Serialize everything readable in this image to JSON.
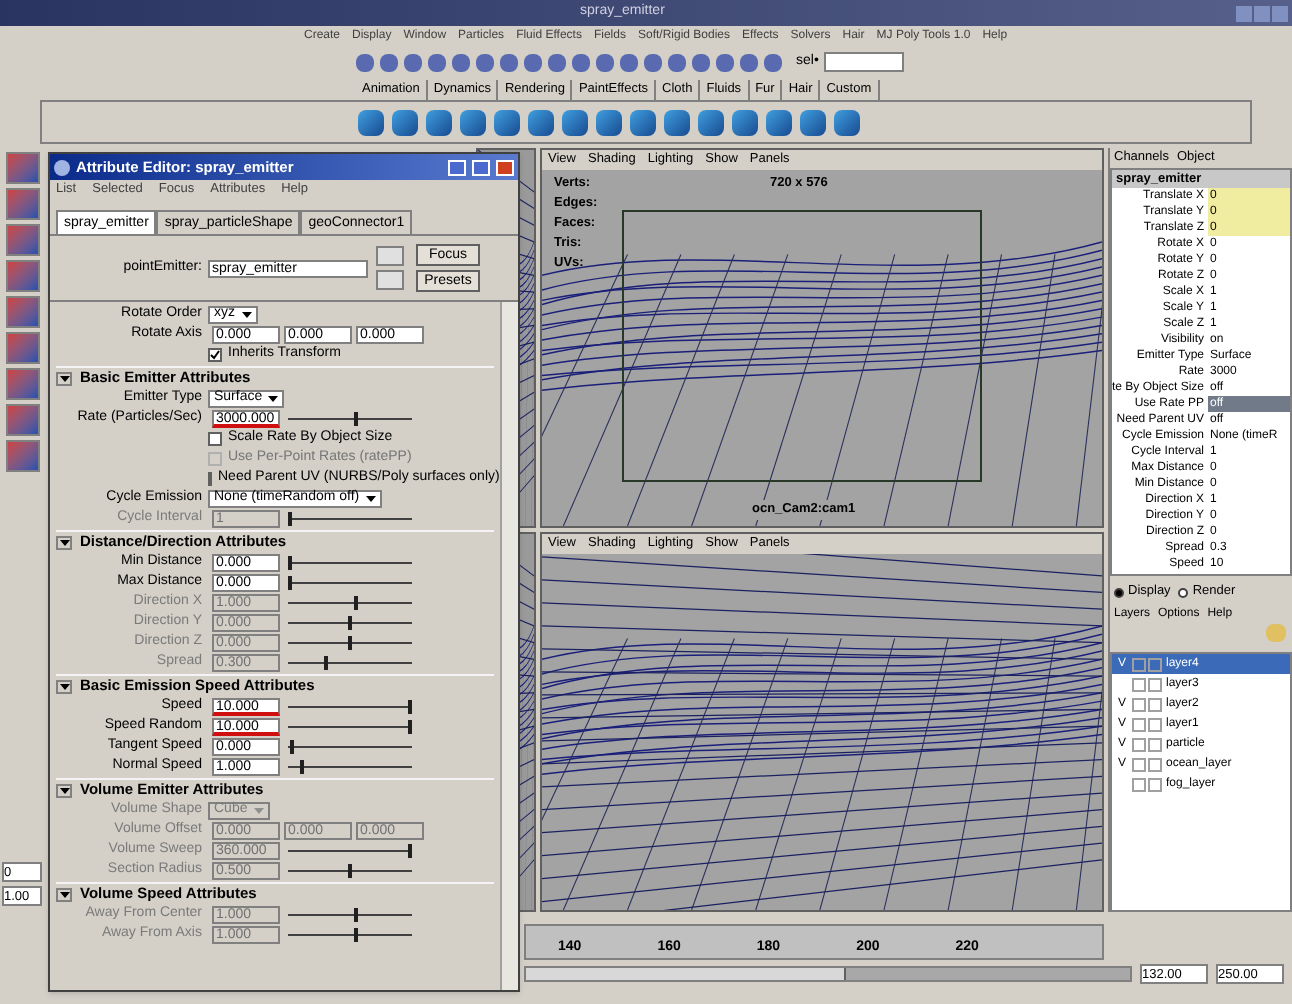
{
  "main_window": {
    "title": "spray_emitter"
  },
  "menu": [
    "Create",
    "Display",
    "Window",
    "Particles",
    "Fluid Effects",
    "Fields",
    "Soft/Rigid Bodies",
    "Effects",
    "Solvers",
    "Hair",
    "MJ Poly Tools 1.0",
    "Help"
  ],
  "toolbar": {
    "selection_label": "sel•"
  },
  "shelf_tabs": [
    {
      "label": "Animation",
      "selected": false
    },
    {
      "label": "Dynamics",
      "selected": false
    },
    {
      "label": "Rendering",
      "selected": false
    },
    {
      "label": "PaintEffects",
      "selected": false
    },
    {
      "label": "Cloth",
      "selected": false
    },
    {
      "label": "Fluids",
      "selected": false
    },
    {
      "label": "Fur",
      "selected": false
    },
    {
      "label": "Hair",
      "selected": false
    },
    {
      "label": "Custom",
      "selected": false
    }
  ],
  "attribute_editor": {
    "title": "Attribute Editor:  spray_emitter",
    "menu": [
      "List",
      "Selected",
      "Focus",
      "Attributes",
      "Help"
    ],
    "tabs": [
      {
        "label": "spray_emitter",
        "selected": true
      },
      {
        "label": "spray_particleShape",
        "selected": false
      },
      {
        "label": "geoConnector1",
        "selected": false
      }
    ],
    "node_label": "pointEmitter:",
    "node_name": "spray_emitter",
    "buttons": [
      "Focus",
      "Presets"
    ],
    "rows": [
      {
        "kind": "dropdown",
        "label": "Rotate Order",
        "value": "xyz",
        "disabled": false
      },
      {
        "kind": "triple",
        "label": "Rotate Axis",
        "values": [
          "0.000",
          "0.000",
          "0.000"
        ],
        "disabled": false
      },
      {
        "kind": "check",
        "label": "Inherits Transform",
        "checked": true,
        "disabled": false
      },
      {
        "kind": "header",
        "label": "Basic Emitter Attributes"
      },
      {
        "kind": "dropdown",
        "label": "Emitter Type",
        "value": "Surface",
        "disabled": false
      },
      {
        "kind": "slider",
        "label": "Rate (Particles/Sec)",
        "value": "3000.000",
        "level": 0.55,
        "disabled": false,
        "underlined": true
      },
      {
        "kind": "check",
        "label": "Scale Rate By Object Size",
        "checked": false,
        "disabled": false
      },
      {
        "kind": "check",
        "label": "Use Per-Point Rates (ratePP)",
        "checked": false,
        "disabled": true
      },
      {
        "kind": "check",
        "label": "Need Parent UV (NURBS/Poly surfaces only)",
        "checked": false,
        "disabled": false
      },
      {
        "kind": "dropdown",
        "label": "Cycle Emission",
        "value": "None (timeRandom off)",
        "disabled": false
      },
      {
        "kind": "slider",
        "label": "Cycle Interval",
        "value": "1",
        "level": 0.0,
        "disabled": true
      },
      {
        "kind": "header",
        "label": "Distance/Direction Attributes"
      },
      {
        "kind": "slider",
        "label": "Min Distance",
        "value": "0.000",
        "level": 0.0,
        "disabled": false
      },
      {
        "kind": "slider",
        "label": "Max Distance",
        "value": "0.000",
        "level": 0.0,
        "disabled": false
      },
      {
        "kind": "slider",
        "label": "Direction X",
        "value": "1.000",
        "level": 0.55,
        "disabled": true
      },
      {
        "kind": "slider",
        "label": "Direction Y",
        "value": "0.000",
        "level": 0.5,
        "disabled": true
      },
      {
        "kind": "slider",
        "label": "Direction Z",
        "value": "0.000",
        "level": 0.5,
        "disabled": true
      },
      {
        "kind": "slider",
        "label": "Spread",
        "value": "0.300",
        "level": 0.3,
        "disabled": true
      },
      {
        "kind": "header",
        "label": "Basic Emission Speed Attributes"
      },
      {
        "kind": "slider",
        "label": "Speed",
        "value": "10.000",
        "level": 1.0,
        "disabled": false,
        "underlined": true
      },
      {
        "kind": "slider",
        "label": "Speed Random",
        "value": "10.000",
        "level": 1.0,
        "disabled": false,
        "underlined": true
      },
      {
        "kind": "slider",
        "label": "Tangent Speed",
        "value": "0.000",
        "level": 0.02,
        "disabled": false
      },
      {
        "kind": "slider",
        "label": "Normal Speed",
        "value": "1.000",
        "level": 0.1,
        "disabled": false
      },
      {
        "kind": "header",
        "label": "Volume Emitter Attributes"
      },
      {
        "kind": "dropdown",
        "label": "Volume Shape",
        "value": "Cube",
        "disabled": true
      },
      {
        "kind": "triple",
        "label": "Volume Offset",
        "values": [
          "0.000",
          "0.000",
          "0.000"
        ],
        "disabled": true
      },
      {
        "kind": "slider",
        "label": "Volume Sweep",
        "value": "360.000",
        "level": 1.0,
        "disabled": true
      },
      {
        "kind": "slider",
        "label": "Section Radius",
        "value": "0.500",
        "level": 0.5,
        "disabled": true
      },
      {
        "kind": "header",
        "label": "Volume Speed Attributes"
      },
      {
        "kind": "slider",
        "label": "Away From Center",
        "value": "1.000",
        "level": 0.55,
        "disabled": true
      },
      {
        "kind": "slider",
        "label": "Away From Axis",
        "value": "1.000",
        "level": 0.55,
        "disabled": true
      }
    ]
  },
  "viewports": [
    {
      "menu": [
        "View",
        "Shading",
        "Lighting",
        "Show",
        "Panels"
      ],
      "hud": [
        "Verts:",
        "Edges:",
        "Faces:",
        "Tris:",
        "UVs:"
      ],
      "resolution": "720 x 576",
      "camera": "ocn_Cam2:cam1"
    },
    {
      "menu": [
        "View",
        "Shading",
        "Lighting",
        "Show",
        "Panels"
      ]
    }
  ],
  "channel_box": {
    "tabs": [
      "Channels",
      "Object"
    ],
    "node": "spray_emitter",
    "channels": [
      {
        "name": "Translate X",
        "value": "0",
        "highlighted": true,
        "selected": false
      },
      {
        "name": "Translate Y",
        "value": "0",
        "highlighted": true,
        "selected": false
      },
      {
        "name": "Translate Z",
        "value": "0",
        "highlighted": true,
        "selected": false
      },
      {
        "name": "Rotate X",
        "value": "0",
        "highlighted": false,
        "selected": false
      },
      {
        "name": "Rotate Y",
        "value": "0",
        "highlighted": false,
        "selected": false
      },
      {
        "name": "Rotate Z",
        "value": "0",
        "highlighted": false,
        "selected": false
      },
      {
        "name": "Scale X",
        "value": "1",
        "highlighted": false,
        "selected": false
      },
      {
        "name": "Scale Y",
        "value": "1",
        "highlighted": false,
        "selected": false
      },
      {
        "name": "Scale Z",
        "value": "1",
        "highlighted": false,
        "selected": false
      },
      {
        "name": "Visibility",
        "value": "on",
        "highlighted": false,
        "selected": false
      },
      {
        "name": "Emitter Type",
        "value": "Surface",
        "highlighted": false,
        "selected": false
      },
      {
        "name": "Rate",
        "value": "3000",
        "highlighted": false,
        "selected": false
      },
      {
        "name": "te By Object Size",
        "value": "off",
        "highlighted": false,
        "selected": false
      },
      {
        "name": "Use Rate PP",
        "value": "off",
        "highlighted": false,
        "selected": true
      },
      {
        "name": "Need Parent UV",
        "value": "off",
        "highlighted": false,
        "selected": false
      },
      {
        "name": "Cycle Emission",
        "value": "None (timeR",
        "highlighted": false,
        "selected": false
      },
      {
        "name": "Cycle Interval",
        "value": "1",
        "highlighted": false,
        "selected": false
      },
      {
        "name": "Max Distance",
        "value": "0",
        "highlighted": false,
        "selected": false
      },
      {
        "name": "Min Distance",
        "value": "0",
        "highlighted": false,
        "selected": false
      },
      {
        "name": "Direction X",
        "value": "1",
        "highlighted": false,
        "selected": false
      },
      {
        "name": "Direction Y",
        "value": "0",
        "highlighted": false,
        "selected": false
      },
      {
        "name": "Direction Z",
        "value": "0",
        "highlighted": false,
        "selected": false
      },
      {
        "name": "Spread",
        "value": "0.3",
        "highlighted": false,
        "selected": false
      },
      {
        "name": "Speed",
        "value": "10",
        "highlighted": false,
        "selected": false
      }
    ]
  },
  "layer_editor": {
    "modes": [
      {
        "label": "Display",
        "selected": true
      },
      {
        "label": "Render",
        "selected": false
      }
    ],
    "menu": [
      "Layers",
      "Options",
      "Help"
    ],
    "layers": [
      {
        "name": "layer4",
        "visibility": "V",
        "selected": true
      },
      {
        "name": "layer3",
        "selected": false
      },
      {
        "name": "layer2",
        "visibility": "V",
        "selected": false
      },
      {
        "name": "layer1",
        "visibility": "V",
        "selected": false
      },
      {
        "name": "particle",
        "visibility": "V",
        "selected": false
      },
      {
        "name": "ocean_layer",
        "visibility": "V",
        "selected": false
      },
      {
        "name": "fog_layer",
        "selected": false
      }
    ]
  },
  "time_slider": {
    "ticks": [
      "140",
      "160",
      "180",
      "200",
      "220"
    ]
  },
  "range_slider": {
    "level": 0.53,
    "current_end": "132.00",
    "end": "250.00"
  },
  "toolbox_fields": [
    "0",
    "1.00"
  ]
}
